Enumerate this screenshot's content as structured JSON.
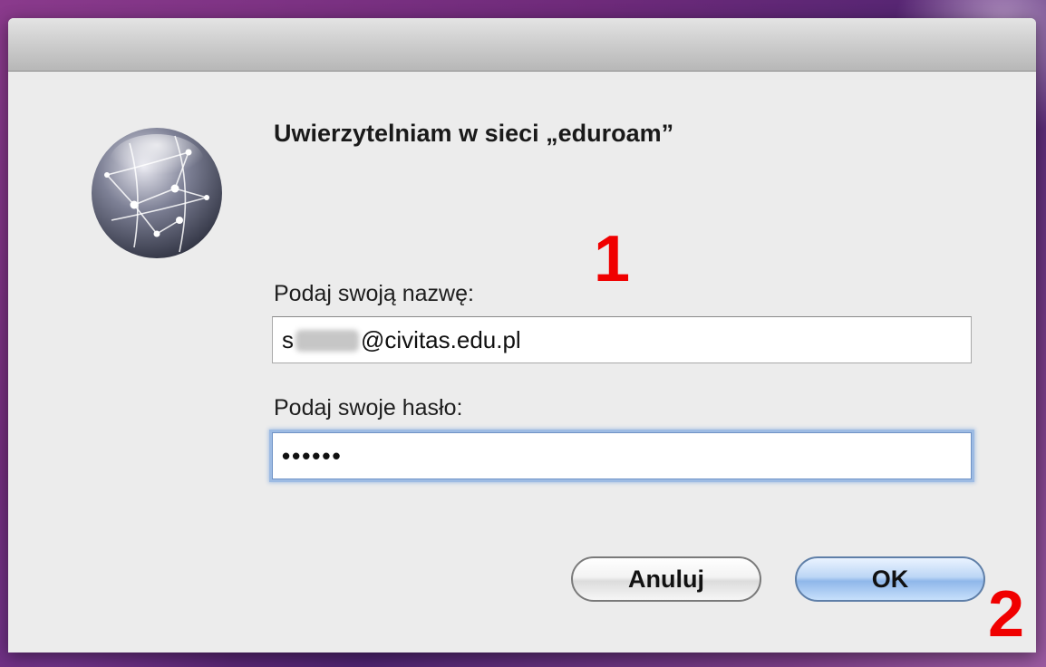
{
  "dialog": {
    "title": "Uwierzytelniam w sieci „eduroam”",
    "icon": "network-globe-icon"
  },
  "form": {
    "username_label": "Podaj swoją nazwę:",
    "username_prefix": "s",
    "username_suffix": "@civitas.edu.pl",
    "password_label": "Podaj swoje hasło:",
    "password_mask": "••••••"
  },
  "buttons": {
    "cancel": "Anuluj",
    "ok": "OK"
  },
  "annotations": {
    "step1": "1",
    "step2": "2"
  },
  "colors": {
    "accent": "#f00000",
    "ok_button": "#8fb7ea"
  }
}
